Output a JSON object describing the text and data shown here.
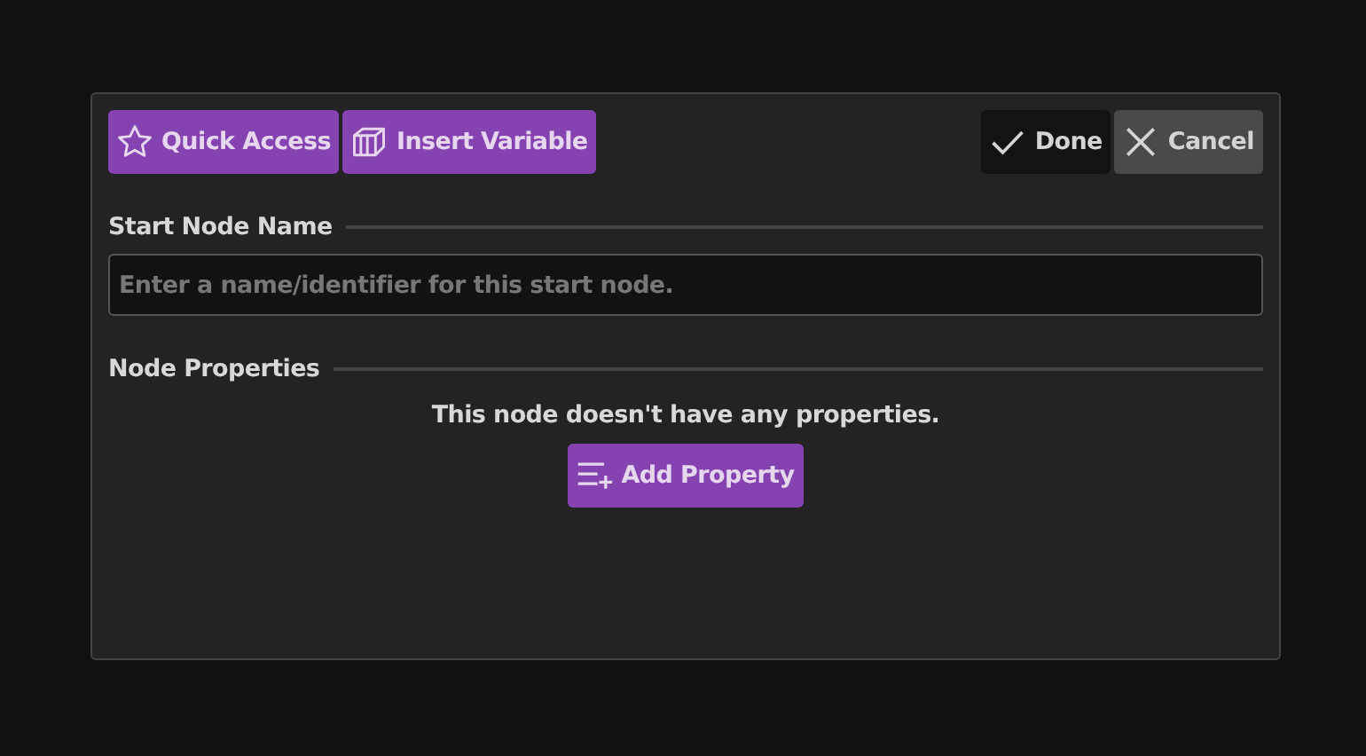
{
  "toolbar": {
    "left_buttons": [
      {
        "kind": "quick_access",
        "label": "Quick Access"
      },
      {
        "kind": "insert_variable",
        "label": "Insert Variable"
      }
    ],
    "right_buttons": [
      {
        "kind": "done",
        "label": "Done"
      },
      {
        "kind": "cancel",
        "label": "Cancel"
      }
    ]
  },
  "name_section": {
    "heading": "Start Node Name",
    "field": {
      "placeholder": "Enter a name/identifier for this start node."
    }
  },
  "properties_section": {
    "heading": "Node Properties",
    "empty_message": "This node doesn't have any properties.",
    "button": {
      "kind": "add_property",
      "label": "Add Property"
    }
  }
}
